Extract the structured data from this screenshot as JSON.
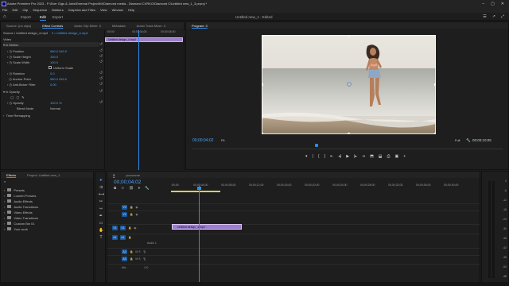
{
  "app": {
    "title": "Adobe Premiere Pro 2023 - F:\\Ever Gigs & Jobs\\External Project\\KKDiamond media - Diamond CVRKO\\Diamond C\\Untitled new_1_3.prproj *"
  },
  "menu": [
    "File",
    "Edit",
    "Clip",
    "Sequence",
    "Markers",
    "Graphics and Titles",
    "View",
    "Window",
    "Help"
  ],
  "workspaces": {
    "items": [
      "Import",
      "Edit",
      "Export"
    ],
    "active": "Edit",
    "document": "Untitled new_1 - Edited"
  },
  "effect_controls": {
    "tabs": [
      "Source: (no clips)",
      "Effect Controls",
      "Audio Clip Mixer: 3",
      "Metadata",
      "Audio Track Mixer: 3"
    ],
    "source_label": "Source • Untitled design_4.mp4",
    "sequence_label": "3 • Untitled design_4.mp4",
    "sections": {
      "video": "Video",
      "motion": "Motion",
      "opacity": "Opacity",
      "time_remap": "Time Remapping"
    },
    "props": {
      "position": {
        "label": "Position",
        "value": "960.0    540.0"
      },
      "scale_height": {
        "label": "Scale Height",
        "value": "100.0"
      },
      "scale_width": {
        "label": "Scale Width",
        "value": "100.0"
      },
      "uniform_scale": {
        "label": "Uniform Scale"
      },
      "rotation": {
        "label": "Rotation",
        "value": "0.0"
      },
      "anchor_point": {
        "label": "Anchor Point",
        "value": "960.0    540.0"
      },
      "anti_flicker": {
        "label": "Anti-flicker Filter",
        "value": "0.00"
      },
      "opacity": {
        "label": "Opacity",
        "value": "100.0 %"
      },
      "blend_mode": {
        "label": "Blend Mode",
        "value": "Normal"
      }
    },
    "mini_timeline": {
      "times": [
        ":00:00",
        "00;00;04;00",
        "00;00;08;00"
      ],
      "clip": "Untitled design_4.mp4"
    },
    "timecode": "00;00;04;02"
  },
  "program": {
    "title": "Program: 3",
    "timecode": "00;00;04;02",
    "fit": "Fit",
    "quality": "Full",
    "duration": "00;00;10;05"
  },
  "project": {
    "tabs": [
      "Effects",
      "Project: Untitled new_1"
    ],
    "items": [
      "Presets",
      "Lumetri Presets",
      "Audio Effects",
      "Audio Transitions",
      "Video Effects",
      "Video Transitions",
      "Custom Bin 01",
      "Your work"
    ]
  },
  "timeline": {
    "tabs": [
      "3",
      "yourname"
    ],
    "timecode": "00;00;04;02",
    "ruler": [
      ":00;00",
      "00;00;04;00",
      "00;00;08;00",
      "00;00;12;00",
      "00;00;16;00",
      "00;00;20;00",
      "00;00;24;00",
      "00;00;28;00",
      "00;00;32;00",
      "00;00;36;00",
      "00;00;40;00"
    ],
    "tracks": {
      "video": [
        "V3",
        "V2",
        "V1"
      ],
      "audio": [
        "A1",
        "A2",
        "A3"
      ],
      "audio_name": "Audio 1",
      "master": "Mix",
      "master_value": "0.0"
    },
    "clip": "Untitled design_4.mp4"
  },
  "meter": {
    "labels": [
      "0",
      "-6",
      "-12",
      "-18",
      "-24",
      "-30",
      "-36",
      "-42",
      "-48",
      "-54",
      "dB"
    ]
  }
}
